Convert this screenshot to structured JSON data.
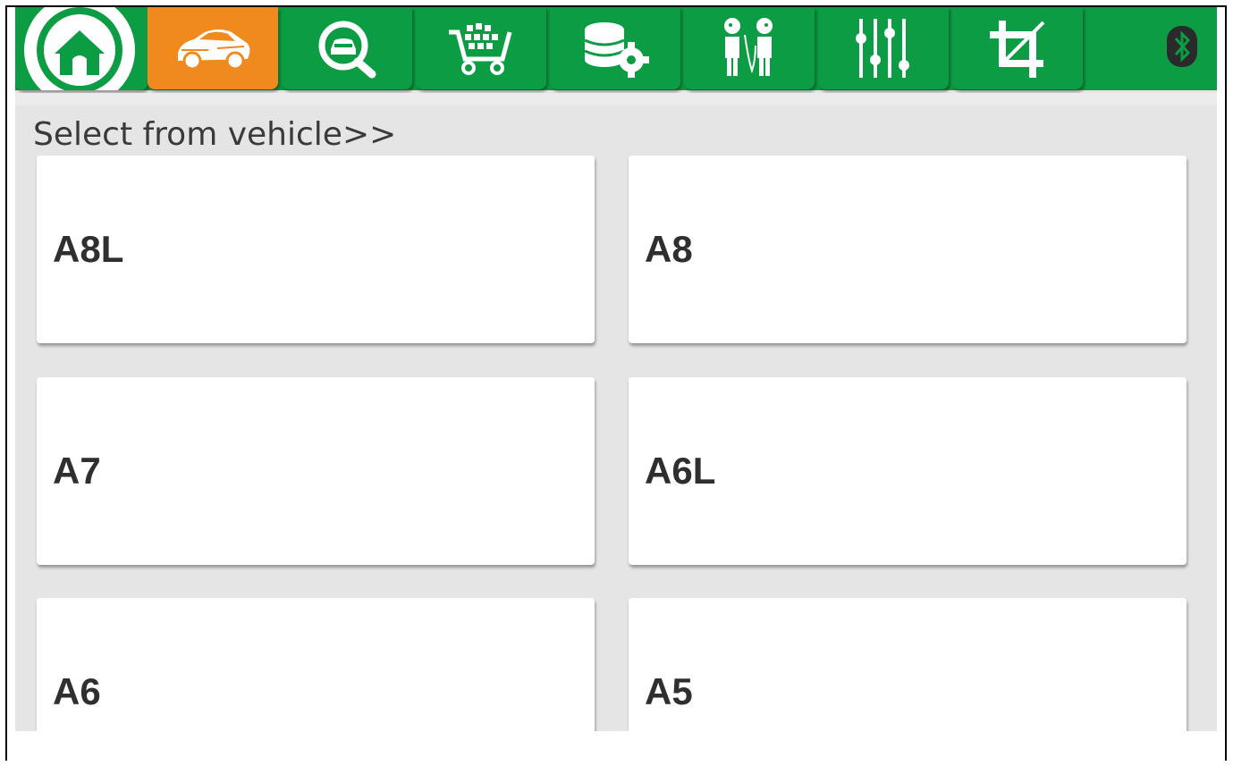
{
  "toolbar": {
    "tabs": [
      {
        "name": "home",
        "icon": "home-icon"
      },
      {
        "name": "vehicle",
        "icon": "car-icon",
        "active": true
      },
      {
        "name": "diagnose",
        "icon": "car-search-icon"
      },
      {
        "name": "shop",
        "icon": "cart-icon"
      },
      {
        "name": "data",
        "icon": "database-gear-icon"
      },
      {
        "name": "support",
        "icon": "people-talking-icon"
      },
      {
        "name": "settings",
        "icon": "sliders-icon"
      },
      {
        "name": "crop",
        "icon": "crop-icon"
      }
    ],
    "bluetooth_icon": "bluetooth-icon",
    "colors": {
      "bar": "#0c9d44",
      "active": "#f08a1e"
    }
  },
  "breadcrumb": "Select from vehicle>>",
  "vehicles": [
    {
      "label": "A8L"
    },
    {
      "label": "A8"
    },
    {
      "label": "A7"
    },
    {
      "label": "A6L"
    },
    {
      "label": "A6"
    },
    {
      "label": "A5"
    }
  ]
}
